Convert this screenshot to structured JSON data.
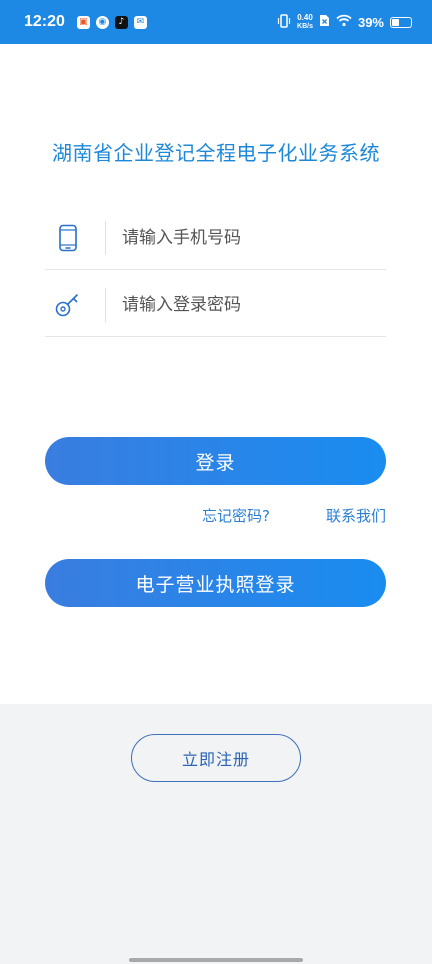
{
  "status_bar": {
    "time": "12:20",
    "net_speed_value": "0.40",
    "net_speed_unit": "KB/s",
    "battery": "39%",
    "apps": [
      "store-icon",
      "weibo-icon",
      "tiktok-icon",
      "mail-icon"
    ]
  },
  "page": {
    "title": "湖南省企业登记全程电子化业务系统"
  },
  "form": {
    "phone_placeholder": "请输入手机号码",
    "password_placeholder": "请输入登录密码"
  },
  "actions": {
    "login_label": "登录",
    "forgot_label": "忘记密码?",
    "contact_label": "联系我们",
    "license_login_label": "电子营业执照登录",
    "register_label": "立即注册"
  },
  "colors": {
    "status_bar": "#1e88e5",
    "accent": "#1e88d8",
    "button_start": "#3a7de0",
    "button_end": "#1a8cf0"
  }
}
